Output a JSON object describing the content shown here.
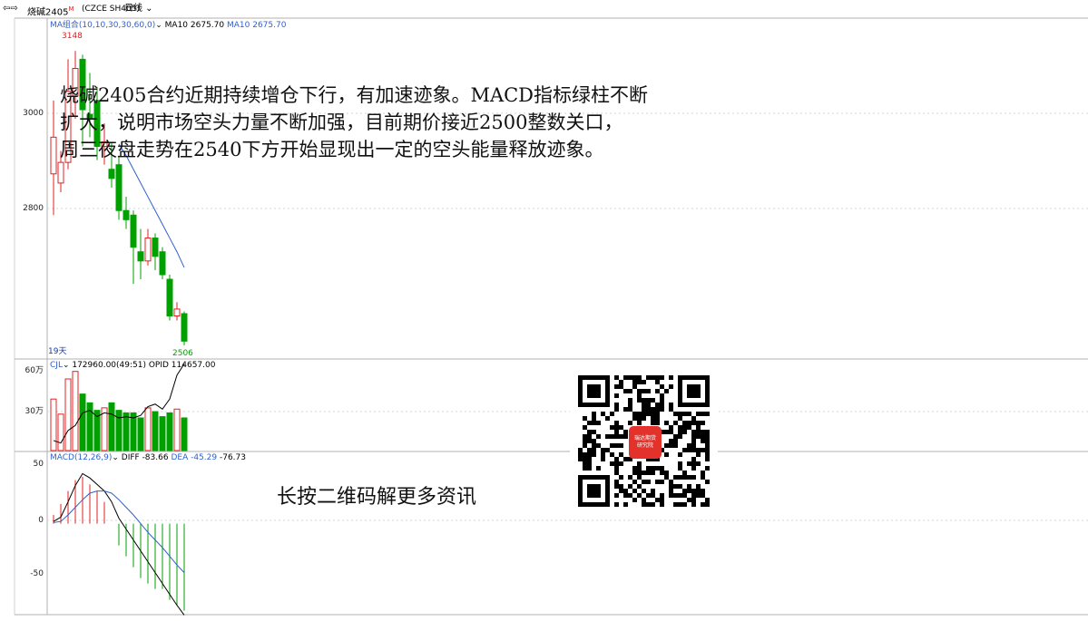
{
  "header": {
    "nav_icon": "back-forward-arrows-icon",
    "symbol": "烧碱2405",
    "sup": "M",
    "code": "(CZCE SH405)",
    "period": "日线",
    "dropdown_icon": "chevron-down-icon"
  },
  "main_pane": {
    "ma_label": "MA组合(10,10,30,30,60,0)",
    "ma_value_1": "MA10 2675.70",
    "ma_value_2": "MA10 2675.70",
    "high_label": "3148",
    "low_label": "2506",
    "days_label": "19天",
    "y_tick_labels": [
      "3000",
      "2800"
    ]
  },
  "volume_pane": {
    "label": "CJL",
    "values_text": "172960.00(49:51)  OPID 114657.00",
    "y_tick_labels": [
      "60万",
      "30万"
    ]
  },
  "macd_pane": {
    "label": "MACD(12,26,9)",
    "diff_text": "DIFF -83.66",
    "dea_text": "DEA -45.29",
    "macd_text": "-76.73",
    "y_tick_labels": [
      "50",
      "0",
      "-50"
    ]
  },
  "commentary": {
    "line1": "烧碱2405合约近期持续增仓下行，有加速迹象。MACD指标绿柱不断",
    "line2": "扩大，说明市场空头力量不断加强，目前期价接近2500整数关口，",
    "line3": "周三夜盘走势在2540下方开始显现出一定的空头能量释放迹象。"
  },
  "qr": {
    "caption": "长按二维码解更多资讯",
    "logo_line1": "瑞达期货",
    "logo_line2": "研究院"
  },
  "colors": {
    "up": "#e02020",
    "down": "#00a000",
    "ma": "#2f5fd0",
    "dea": "#2f5fd0",
    "diff": "#000000",
    "opi": "#000000",
    "grid": "#b0b0b0"
  },
  "chart_data": [
    {
      "type": "candlestick",
      "ylim": [
        2480,
        3200
      ],
      "high_label_value": 3148,
      "low_label_value": 2506,
      "candles": [
        {
          "o": 2880,
          "h": 3040,
          "l": 2790,
          "c": 2960
        },
        {
          "o": 2860,
          "h": 2930,
          "l": 2840,
          "c": 2905
        },
        {
          "o": 2905,
          "h": 3130,
          "l": 2890,
          "c": 3060
        },
        {
          "o": 3050,
          "h": 3148,
          "l": 3000,
          "c": 3110
        },
        {
          "o": 3130,
          "h": 3140,
          "l": 2940,
          "c": 3020
        },
        {
          "o": 3010,
          "h": 3100,
          "l": 2960,
          "c": 3000
        },
        {
          "o": 3040,
          "h": 3070,
          "l": 2910,
          "c": 2940
        },
        {
          "o": 2940,
          "h": 2990,
          "l": 2900,
          "c": 2950
        },
        {
          "o": 2890,
          "h": 2950,
          "l": 2850,
          "c": 2870
        },
        {
          "o": 2900,
          "h": 2920,
          "l": 2780,
          "c": 2800
        },
        {
          "o": 2800,
          "h": 2830,
          "l": 2760,
          "c": 2780
        },
        {
          "o": 2790,
          "h": 2800,
          "l": 2640,
          "c": 2720
        },
        {
          "o": 2710,
          "h": 2760,
          "l": 2650,
          "c": 2690
        },
        {
          "o": 2690,
          "h": 2760,
          "l": 2680,
          "c": 2740
        },
        {
          "o": 2740,
          "h": 2750,
          "l": 2670,
          "c": 2700
        },
        {
          "o": 2710,
          "h": 2720,
          "l": 2650,
          "c": 2660
        },
        {
          "o": 2650,
          "h": 2660,
          "l": 2560,
          "c": 2570
        },
        {
          "o": 2570,
          "h": 2600,
          "l": 2560,
          "c": 2585
        },
        {
          "o": 2575,
          "h": 2580,
          "l": 2506,
          "c": 2515
        }
      ],
      "ma_start_index": 9,
      "ma": [
        2945,
        2920,
        2890,
        2860,
        2830,
        2800,
        2770,
        2740,
        2710,
        2675.7
      ]
    },
    {
      "type": "bar",
      "series": [
        {
          "name": "CJL",
          "values": [
            410000,
            290000,
            570000,
            630000,
            450000,
            380000,
            320000,
            340000,
            380000,
            320000,
            300000,
            300000,
            260000,
            340000,
            310000,
            270000,
            300000,
            330000,
            260000
          ]
        },
        {
          "name": "OPID",
          "values": [
            80000,
            60000,
            160000,
            200000,
            300000,
            320000,
            270000,
            300000,
            290000,
            260000,
            270000,
            260000,
            280000,
            350000,
            370000,
            330000,
            410000,
            600000,
            690000
          ]
        }
      ],
      "ylim": [
        0,
        700000
      ]
    },
    {
      "type": "bar",
      "series": [
        {
          "name": "MACD",
          "values": [
            8,
            18,
            30,
            40,
            43,
            36,
            30,
            20,
            0,
            -20,
            -30,
            -40,
            -50,
            -55,
            -60,
            -60,
            -70,
            -75,
            -80
          ]
        },
        {
          "name": "DIFF",
          "values": [
            2,
            6,
            20,
            35,
            46,
            42,
            36,
            30,
            20,
            5,
            -5,
            -15,
            -25,
            -35,
            -45,
            -55,
            -65,
            -75,
            -84
          ]
        },
        {
          "name": "DEA",
          "values": [
            1,
            2,
            8,
            15,
            22,
            28,
            30,
            30,
            28,
            22,
            15,
            8,
            0,
            -8,
            -15,
            -22,
            -30,
            -38,
            -45
          ]
        }
      ],
      "ylim": [
        -82,
        58
      ]
    }
  ]
}
